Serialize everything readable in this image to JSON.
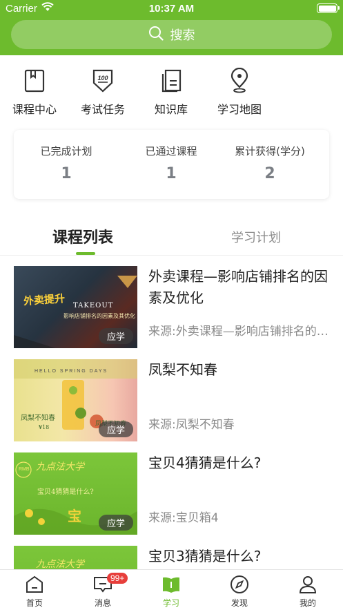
{
  "status_bar": {
    "carrier": "Carrier",
    "time": "10:37 AM"
  },
  "search": {
    "label": "搜索",
    "icon": "search-icon"
  },
  "quick_links": [
    {
      "label": "课程中心",
      "icon": "bookmark-book-icon"
    },
    {
      "label": "考试任务",
      "icon": "exam-100-icon"
    },
    {
      "label": "知识库",
      "icon": "knowledge-book-icon"
    },
    {
      "label": "学习地图",
      "icon": "map-pin-icon"
    }
  ],
  "stats": [
    {
      "label": "已完成计划",
      "value": "1"
    },
    {
      "label": "已通过课程",
      "value": "1"
    },
    {
      "label": "累计获得(学分)",
      "value": "2"
    }
  ],
  "tabs": {
    "active": "课程列表",
    "inactive": "学习计划"
  },
  "courses": [
    {
      "title": "外卖课程—影响店铺排名的因素及优化",
      "source": "来源:外卖课程—影响店铺排名的因素及优化",
      "badge": "应学",
      "thumb_text": [
        "外卖提升",
        "TAKEOUT",
        "影响店铺排名的因素及其优化"
      ]
    },
    {
      "title": "凤梨不知春",
      "source": "来源:凤梨不知春",
      "badge": "应学",
      "thumb_text": [
        "HELLO SPRING DAYS",
        "凤梨不知春",
        "凤梨不知春",
        "¥18"
      ]
    },
    {
      "title": "宝贝4猜猜是什么?",
      "source": "来源:宝贝箱4",
      "badge": "应学",
      "thumb_text": [
        "RMB",
        "九点法大学",
        "宝贝4猜猜是什么?",
        "宝"
      ]
    },
    {
      "title": "宝贝3猜猜是什么?",
      "thumb_text": [
        "九点法大学"
      ]
    }
  ],
  "tabbar": [
    {
      "label": "首页",
      "icon": "home-icon"
    },
    {
      "label": "消息",
      "icon": "message-icon",
      "badge": "99+"
    },
    {
      "label": "学习",
      "icon": "study-book-icon",
      "active": true
    },
    {
      "label": "发现",
      "icon": "compass-icon"
    },
    {
      "label": "我的",
      "icon": "person-icon"
    }
  ],
  "colors": {
    "brand": "#6dbb2d",
    "badge": "#e73e3b"
  }
}
